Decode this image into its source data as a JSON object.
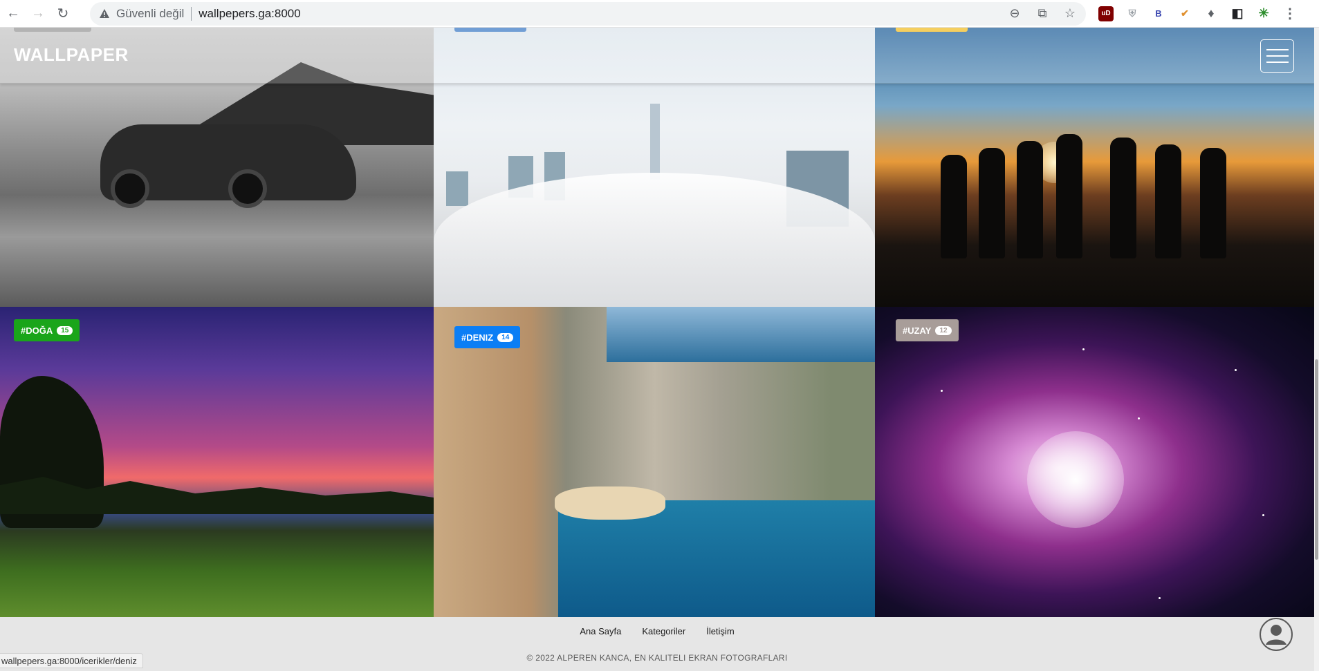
{
  "browser": {
    "back_icon": "arrow-left-icon",
    "forward_icon": "arrow-right-icon",
    "reload_icon": "reload-icon",
    "security_label": "Güvenli değil",
    "url": "wallpepers.ga:8000",
    "zoom_icon": "zoom-out-icon",
    "share_icon": "share-icon",
    "bookmark_icon": "star-icon",
    "extensions": [
      "ublock-icon",
      "shield-icon",
      "b-icon",
      "person-check-icon",
      "puzzle-icon",
      "sidebar-icon",
      "green-sync-icon",
      "more-vert-icon"
    ],
    "ext_ub_label": "uD",
    "ext_b_label": "B"
  },
  "navbar": {
    "brand": "WALLPAPER",
    "menu_icon": "hamburger-icon"
  },
  "tiles": [
    {
      "name": "car",
      "tag": null
    },
    {
      "name": "city",
      "tag": null
    },
    {
      "name": "people",
      "tag": null
    },
    {
      "name": "nature",
      "tag": {
        "label": "#DOĞA",
        "count": "15",
        "color": "#1aa51a"
      }
    },
    {
      "name": "sea",
      "tag": {
        "label": "#DENIZ",
        "count": "14",
        "color": "#0b7ef5"
      }
    },
    {
      "name": "space",
      "tag": {
        "label": "#UZAY",
        "count": "12",
        "color": "#a89d99"
      }
    }
  ],
  "footer": {
    "links": [
      "Ana Sayfa",
      "Kategoriler",
      "İletişim"
    ],
    "copyright": "© 2022 ALPEREN KANCA, EN KALITELI EKRAN FOTOGRAFLARI",
    "user_icon": "user-circle-icon"
  },
  "status_bar": {
    "url": "wallpepers.ga:8000/icerikler/deniz"
  },
  "colors": {
    "doga": "#1aa51a",
    "deniz": "#0b7ef5",
    "uzay": "#a89d99",
    "peek_gray": "#9e9e9e",
    "peek_blue": "#4a83c9",
    "peek_yellow": "#f2c232"
  }
}
